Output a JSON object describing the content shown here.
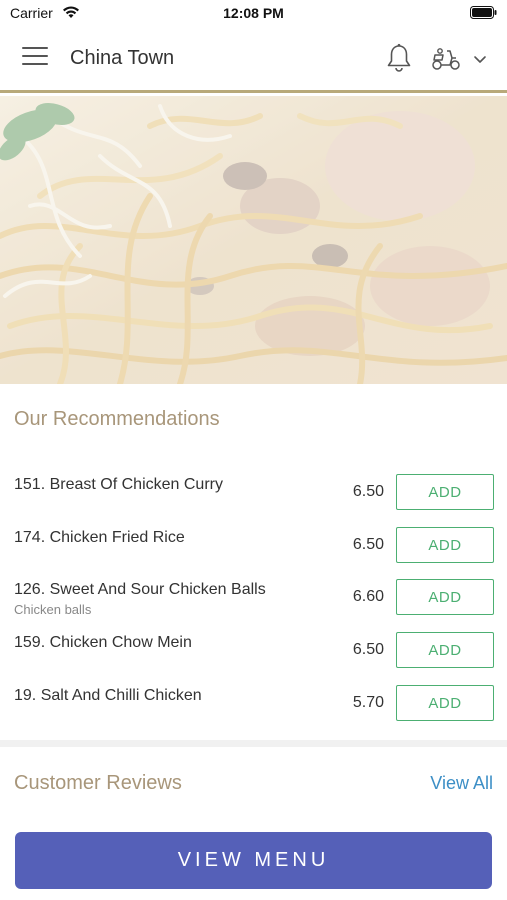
{
  "status_bar": {
    "carrier": "Carrier",
    "time": "12:08 PM",
    "wifi_icon": "wifi-icon",
    "battery_icon": "battery-icon"
  },
  "header": {
    "title": "China Town",
    "menu_icon": "hamburger-menu-icon",
    "notification_icon": "bell-icon",
    "order_type_icon": "scooter-delivery-icon",
    "dropdown_icon": "chevron-down-icon",
    "accent_color": "#b8a97a"
  },
  "hero": {
    "image": "noodle-dish-photo"
  },
  "recommendations": {
    "title": "Our Recommendations",
    "items": [
      {
        "name": "151. Breast Of Chicken Curry",
        "description": "",
        "price": "6.50",
        "add_label": "ADD"
      },
      {
        "name": "174. Chicken Fried Rice",
        "description": "",
        "price": "6.50",
        "add_label": "ADD"
      },
      {
        "name": "126. Sweet And Sour Chicken Balls",
        "description": "Chicken balls",
        "price": "6.60",
        "add_label": "ADD"
      },
      {
        "name": "159. Chicken Chow Mein",
        "description": "",
        "price": "6.50",
        "add_label": "ADD"
      },
      {
        "name": "19. Salt And Chilli Chicken",
        "description": "",
        "price": "5.70",
        "add_label": "ADD"
      }
    ]
  },
  "reviews": {
    "title": "Customer Reviews",
    "view_all_label": "View All"
  },
  "footer": {
    "view_menu_label": "VIEW MENU",
    "button_color": "#5560b8"
  },
  "colors": {
    "section_title": "#a8967a",
    "add_button": "#4caf72",
    "link": "#3d8fc6"
  }
}
